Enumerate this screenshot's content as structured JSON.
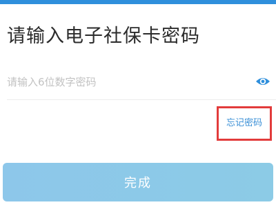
{
  "header": {
    "title": "请输入电子社保卡密码"
  },
  "password": {
    "placeholder": "请输入6位数字密码",
    "value": "",
    "visibility_icon": "eye-icon"
  },
  "links": {
    "forgot_password": "忘记密码"
  },
  "actions": {
    "done_label": "完成"
  },
  "colors": {
    "accent": "#2f8fdc",
    "link": "#3a8fd6",
    "highlight_border": "#e23b3b",
    "button_bg": "#8dc7ea"
  }
}
